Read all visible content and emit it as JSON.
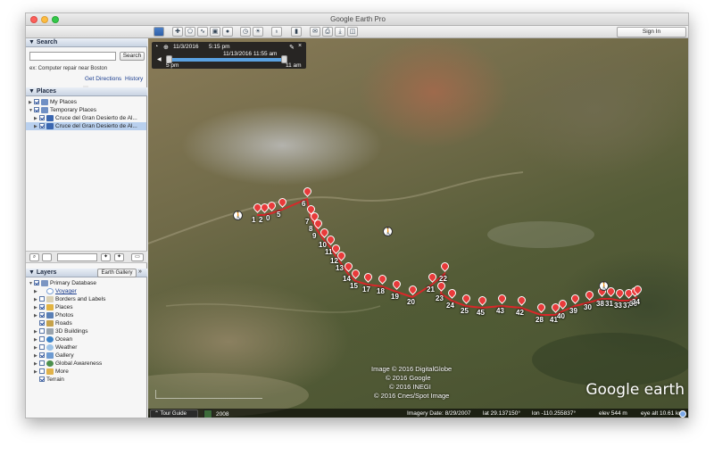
{
  "window": {
    "title": "Google Earth Pro",
    "signin_label": "Sign In"
  },
  "search": {
    "header": "Search",
    "placeholder": "",
    "button_label": "Search",
    "example": "ex: Computer repair near Boston",
    "get_directions": "Get Directions",
    "history": "History"
  },
  "places": {
    "header": "Places",
    "items": [
      {
        "label": "My Places",
        "checked": true
      },
      {
        "label": "Temporary Places",
        "checked": true
      },
      {
        "label": "Cruce del Gran Desierto de Al...",
        "checked": true
      },
      {
        "label": "Cruce del Gran Desierto de Al...",
        "checked": true,
        "selected": true
      }
    ]
  },
  "layers": {
    "header": "Layers",
    "gallery_button": "Earth Gallery",
    "gallery_chevron": "»",
    "items": [
      {
        "label": "Primary Database",
        "checked": true
      },
      {
        "label": "Voyager",
        "checked": false,
        "link": true
      },
      {
        "label": "Borders and Labels",
        "checked": false
      },
      {
        "label": "Places",
        "checked": true
      },
      {
        "label": "Photos",
        "checked": true
      },
      {
        "label": "Roads",
        "checked": true
      },
      {
        "label": "3D Buildings",
        "checked": false
      },
      {
        "label": "Ocean",
        "checked": false
      },
      {
        "label": "Weather",
        "checked": false
      },
      {
        "label": "Gallery",
        "checked": true
      },
      {
        "label": "Global Awareness",
        "checked": false
      },
      {
        "label": "More",
        "checked": false
      },
      {
        "label": "Terrain",
        "checked": true
      }
    ]
  },
  "timebar": {
    "start_date": "11/3/2016",
    "start_time": "5:15 pm",
    "current": "11/13/2016  11:55 am",
    "left_label": "5 pm",
    "right_label": "11 am"
  },
  "map": {
    "markers": [
      "1",
      "2",
      "0",
      "5",
      "6",
      "7",
      "8",
      "9",
      "10",
      "11",
      "12",
      "13",
      "14",
      "15",
      "17",
      "18",
      "19",
      "20",
      "21",
      "22",
      "23",
      "24",
      "25",
      "45",
      "43",
      "42",
      "28",
      "41",
      "40",
      "39",
      "30",
      "38",
      "31",
      "33",
      "37",
      "36",
      "34"
    ],
    "credits": [
      "Image © 2016 DigitalGlobe",
      "© 2016 Google",
      "© 2016 INEGI",
      "© 2016 Cnes/Spot Image"
    ],
    "logo": "Google earth"
  },
  "status": {
    "tour_guide": "Tour Guide",
    "year": "2008",
    "imagery_date": "Imagery Date: 8/29/2007",
    "lat": "lat   29.137150°",
    "lon": "lon  -110.255837°",
    "elev": "elev   544 m",
    "eye_alt": "eye alt   10.61 km"
  }
}
